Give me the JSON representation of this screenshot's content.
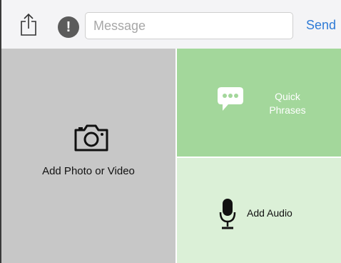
{
  "toolbar": {
    "share_icon": "share-icon",
    "alert_icon": "exclamation-icon",
    "alert_glyph": "!",
    "message_placeholder": "Message",
    "send_label": "Send"
  },
  "tiles": {
    "photo": {
      "icon": "camera-icon",
      "label": "Add Photo or Video"
    },
    "phrases": {
      "icon": "chat-bubble-icon",
      "label_line1": "Quick",
      "label_line2": "Phrases"
    },
    "audio": {
      "icon": "microphone-icon",
      "label": "Add Audio"
    }
  },
  "colors": {
    "toolbar_bg": "#f4f4f6",
    "send_blue": "#2f7bd6",
    "photo_tile": "#c7c7c7",
    "phrases_tile": "#a3d79b",
    "audio_tile": "#dbf0d7"
  }
}
